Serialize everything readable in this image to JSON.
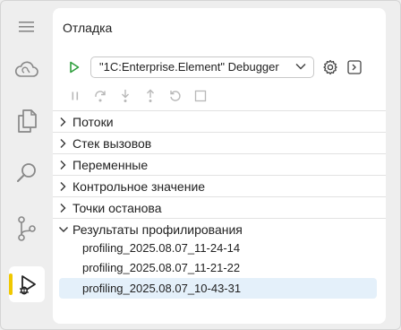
{
  "activity_bar": {
    "items": [
      {
        "icon": "hamburger-menu-icon"
      },
      {
        "icon": "cloud-icon"
      },
      {
        "icon": "explorer-files-icon"
      },
      {
        "icon": "search-icon"
      },
      {
        "icon": "source-control-icon"
      },
      {
        "icon": "run-debug-icon",
        "active": true
      }
    ],
    "active_indicator_color": "#f0c800"
  },
  "panel": {
    "title": "Отладка",
    "config_select": {
      "value": "\"1C:Enterprise.Element\" Debugger"
    },
    "colors": {
      "accent_run": "#2e9e3c",
      "selection": "#e4f0fa"
    },
    "sections": [
      {
        "label": "Потоки",
        "expanded": false
      },
      {
        "label": "Стек вызовов",
        "expanded": false
      },
      {
        "label": "Переменные",
        "expanded": false
      },
      {
        "label": "Контрольное значение",
        "expanded": false
      },
      {
        "label": "Точки останова",
        "expanded": false
      },
      {
        "label": "Результаты профилирования",
        "expanded": true
      }
    ],
    "profiling_results": [
      {
        "label": "profiling_2025.08.07_11-24-14",
        "selected": false
      },
      {
        "label": "profiling_2025.08.07_11-21-22",
        "selected": false
      },
      {
        "label": "profiling_2025.08.07_10-43-31",
        "selected": true
      }
    ]
  }
}
